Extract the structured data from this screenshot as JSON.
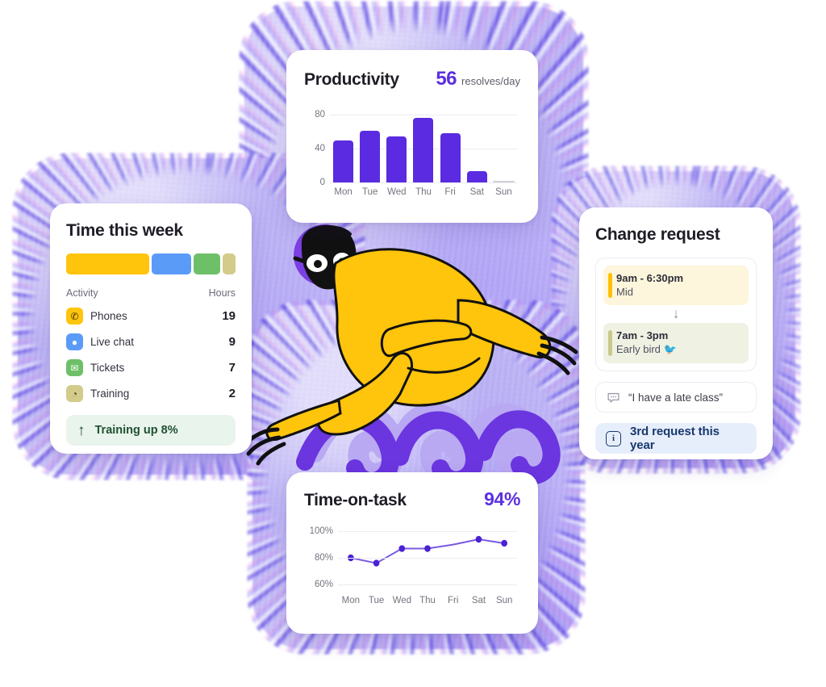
{
  "productivity": {
    "title": "Productivity",
    "value": "56",
    "unit": "resolves/day",
    "accent": "#5a2be0"
  },
  "time_this_week": {
    "title": "Time this week",
    "col_activity": "Activity",
    "col_hours": "Hours",
    "segments": [
      {
        "name": "Phones",
        "color": "#FFC40C",
        "pct": 51.4
      },
      {
        "name": "Live chat",
        "color": "#5B9BF8",
        "pct": 24.3
      },
      {
        "name": "Tickets",
        "color": "#6DC068",
        "pct": 16.2
      },
      {
        "name": "Training",
        "color": "#D2CB8A",
        "pct": 8.1
      }
    ],
    "rows": [
      {
        "icon": "phone-icon",
        "glyph": "✆",
        "icon_bg": "#FFC40C",
        "icon_color": "#3a2a00",
        "label": "Phones",
        "hours": "19"
      },
      {
        "icon": "chat-bubble-icon",
        "glyph": "●",
        "icon_bg": "#5B9BF8",
        "icon_color": "#ffffff",
        "label": "Live chat",
        "hours": "9"
      },
      {
        "icon": "envelope-icon",
        "glyph": "✉",
        "icon_bg": "#6DC068",
        "icon_color": "#ffffff",
        "label": "Tickets",
        "hours": "7"
      },
      {
        "icon": "owl-icon",
        "glyph": "◔",
        "icon_bg": "#D2CB8A",
        "icon_color": "#4a4520",
        "label": "Training",
        "hours": "2"
      }
    ],
    "banner": {
      "icon": "arrow-up-icon",
      "glyph": "↑",
      "text": "Training up 8%",
      "bg": "#e9f4ec",
      "color": "#1f5132"
    }
  },
  "change_request": {
    "title": "Change request",
    "shift_from": {
      "time": "9am - 6:30pm",
      "name": "Mid",
      "accent": "#FFC107",
      "bg": "#FDF6DC"
    },
    "arrow_glyph": "↓",
    "shift_to": {
      "time": "7am - 3pm",
      "name": "Early bird 🐦",
      "accent": "#C8C88A",
      "bg": "#EFF2E3"
    },
    "quote": {
      "icon": "speech-bubble-icon",
      "text": "“I have a late class”"
    },
    "banner": {
      "icon": "info-icon",
      "glyph": "i",
      "text": "3rd request this year",
      "bg": "#e7eefb",
      "color": "#17386d"
    }
  },
  "time_on_task": {
    "title": "Time-on-task",
    "value": "94%",
    "accent": "#5a2be0"
  },
  "illustration": {
    "name": "swimmer-diver-illustration",
    "body_color": "#FFC40C",
    "cap_color": "#7B3FE4",
    "wave_color": "#6B35E0",
    "wave_color_light": "#B9A8F2",
    "outline_color": "#111111"
  },
  "chart_data": [
    {
      "type": "bar",
      "title": "Productivity",
      "categories": [
        "Mon",
        "Tue",
        "Wed",
        "Thu",
        "Fri",
        "Sat",
        "Sun"
      ],
      "values": [
        50,
        61,
        55,
        77,
        58,
        13,
        0
      ],
      "xlabel": "",
      "ylabel": "",
      "ylim": [
        0,
        90
      ],
      "yticks": [
        0,
        40,
        80
      ],
      "ytick_labels": [
        "0",
        "40",
        "80"
      ],
      "grid": true,
      "legend": false,
      "bar_color": "#5a2be0",
      "annotation": "56 resolves/day"
    },
    {
      "type": "line",
      "title": "Time-on-task",
      "categories": [
        "Mon",
        "Tue",
        "Wed",
        "Thu",
        "Fri",
        "Sat",
        "Sun"
      ],
      "values": [
        80,
        76,
        87,
        87,
        90,
        94,
        91
      ],
      "markers": [
        true,
        true,
        true,
        true,
        false,
        true,
        true
      ],
      "xlabel": "",
      "ylabel": "",
      "ylim": [
        55,
        105
      ],
      "yticks": [
        60,
        80,
        100
      ],
      "ytick_labels": [
        "60%",
        "80%",
        "100%"
      ],
      "grid": true,
      "legend": false,
      "line_color": "#7B5AE0",
      "marker_color": "#4A21D6",
      "annotation": "94%"
    }
  ]
}
